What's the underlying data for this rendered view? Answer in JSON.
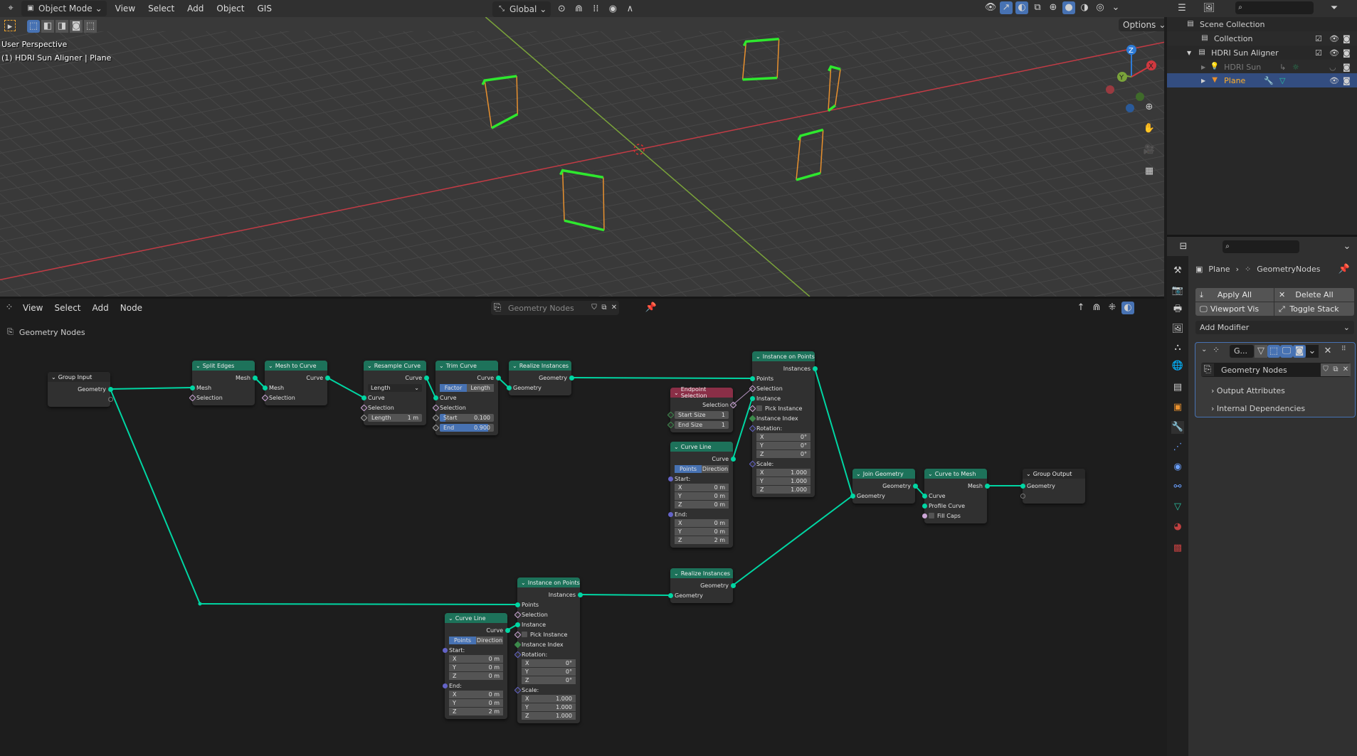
{
  "colors": {
    "accent": "#4772b3",
    "geometry_socket": "#00d6a3",
    "node_header_geometry": "#1d725a",
    "node_header_input": "#8a2f47",
    "node_header_group": "#282828",
    "active_object": "#ffaf29",
    "x_axis": "#c33b45",
    "y_axis": "#7aa33a",
    "selection_green": "#2ee82e",
    "selection_orange": "#e8902e"
  },
  "top_header": {
    "editor_icon": "axis-gizmo-icon",
    "mode": "Object Mode",
    "menus": [
      "View",
      "Select",
      "Add",
      "Object",
      "GIS"
    ],
    "transform_orientation": "Global",
    "options": "Options"
  },
  "viewport": {
    "view_name": "User Perspective",
    "object_info": "(1) HDRI Sun Aligner | Plane",
    "gizmo": {
      "x": "X",
      "y": "Y",
      "z": "Z"
    }
  },
  "outliner": {
    "rows": [
      {
        "label": "Scene Collection",
        "icon": "collection-icon"
      },
      {
        "label": "Collection",
        "icon": "collection-icon"
      },
      {
        "label": "HDRI Sun Aligner",
        "icon": "collection-icon"
      },
      {
        "label": "HDRI Sun",
        "icon": "light-icon"
      },
      {
        "label": "Plane",
        "icon": "mesh-icon",
        "selected": true
      }
    ]
  },
  "properties": {
    "breadcrumb": [
      "Plane",
      "GeometryNodes"
    ],
    "apply_all": "Apply All",
    "delete_all": "Delete All",
    "viewport_vis": "Viewport Vis",
    "toggle_stack": "Toggle Stack",
    "add_modifier": "Add Modifier",
    "modifier": {
      "name": "G...",
      "node_group": "Geometry Nodes",
      "sections": [
        "Output Attributes",
        "Internal Dependencies"
      ]
    }
  },
  "node_editor": {
    "menus": [
      "View",
      "Select",
      "Add",
      "Node"
    ],
    "node_group": "Geometry Nodes",
    "breadcrumb": "Geometry Nodes"
  },
  "nodes": {
    "group_input": {
      "title": "Group Input",
      "header": "group",
      "rows": [
        {
          "k": "out",
          "label": "Geometry",
          "s": "geo"
        },
        {
          "k": "out",
          "label": "",
          "s": "empty"
        }
      ]
    },
    "split_edges": {
      "title": "Split Edges",
      "header": "geo",
      "rows": [
        {
          "k": "out",
          "label": "Mesh",
          "s": "geo"
        },
        {
          "k": "in",
          "label": "Mesh",
          "s": "geo"
        },
        {
          "k": "in",
          "label": "Selection",
          "s": "field"
        }
      ]
    },
    "mesh_to_curve": {
      "title": "Mesh to Curve",
      "header": "geo",
      "rows": [
        {
          "k": "out",
          "label": "Curve",
          "s": "geo"
        },
        {
          "k": "in",
          "label": "Mesh",
          "s": "geo"
        },
        {
          "k": "in",
          "label": "Selection",
          "s": "field"
        }
      ]
    },
    "resample": {
      "title": "Resample Curve",
      "header": "geo",
      "rows": [
        {
          "k": "out",
          "label": "Curve",
          "s": "geo"
        },
        {
          "k": "select",
          "label": "Length"
        },
        {
          "k": "in",
          "label": "Curve",
          "s": "geo"
        },
        {
          "k": "in",
          "label": "Selection",
          "s": "field"
        },
        {
          "k": "field",
          "label": "Length",
          "value": "1 m",
          "s": "float"
        }
      ]
    },
    "trim": {
      "title": "Trim Curve",
      "header": "geo",
      "rows": [
        {
          "k": "out",
          "label": "Curve",
          "s": "geo"
        },
        {
          "k": "toggle",
          "options": [
            "Factor",
            "Length"
          ],
          "active": 0
        },
        {
          "k": "in",
          "label": "Curve",
          "s": "geo"
        },
        {
          "k": "in",
          "label": "Selection",
          "s": "field"
        },
        {
          "k": "field",
          "label": "Start",
          "value": "0.100",
          "fill": 0.1,
          "s": "float"
        },
        {
          "k": "field",
          "label": "End",
          "value": "0.900",
          "fill": 0.9,
          "s": "float"
        }
      ]
    },
    "realize1": {
      "title": "Realize Instances",
      "header": "geo",
      "rows": [
        {
          "k": "out",
          "label": "Geometry",
          "s": "geo"
        },
        {
          "k": "in",
          "label": "Geometry",
          "s": "geo"
        }
      ]
    },
    "endpoint": {
      "title": "Endpoint Selection",
      "header": "input",
      "rows": [
        {
          "k": "out",
          "label": "Selection",
          "s": "field"
        },
        {
          "k": "field",
          "label": "Start Size",
          "value": "1",
          "s": "intd"
        },
        {
          "k": "field",
          "label": "End Size",
          "value": "1",
          "s": "intd"
        }
      ]
    },
    "iop1": {
      "title": "Instance on Points",
      "header": "geo",
      "rows": [
        {
          "k": "out",
          "label": "Instances",
          "s": "geo"
        },
        {
          "k": "in",
          "label": "Points",
          "s": "geo"
        },
        {
          "k": "in",
          "label": "Selection",
          "s": "field"
        },
        {
          "k": "in",
          "label": "Instance",
          "s": "geo"
        },
        {
          "k": "check",
          "label": "Pick Instance",
          "s": "field"
        },
        {
          "k": "in",
          "label": "Instance Index",
          "s": "int"
        },
        {
          "k": "in",
          "label": "Rotation:",
          "s": "vec"
        },
        {
          "k": "xyz",
          "label": "X",
          "value": "0°"
        },
        {
          "k": "xyz",
          "label": "Y",
          "value": "0°"
        },
        {
          "k": "xyz",
          "label": "Z",
          "value": "0°"
        },
        {
          "k": "in",
          "label": "Scale:",
          "s": "vec"
        },
        {
          "k": "xyz",
          "label": "X",
          "value": "1.000"
        },
        {
          "k": "xyz",
          "label": "Y",
          "value": "1.000"
        },
        {
          "k": "xyz",
          "label": "Z",
          "value": "1.000"
        }
      ]
    },
    "curveline1": {
      "title": "Curve Line",
      "header": "geo",
      "rows": [
        {
          "k": "out",
          "label": "Curve",
          "s": "geo"
        },
        {
          "k": "toggle",
          "options": [
            "Points",
            "Direction"
          ],
          "active": 0
        },
        {
          "k": "in",
          "label": "Start:",
          "s": "vecc"
        },
        {
          "k": "xyz",
          "label": "X",
          "value": "0 m"
        },
        {
          "k": "xyz",
          "label": "Y",
          "value": "0 m"
        },
        {
          "k": "xyz",
          "label": "Z",
          "value": "0 m"
        },
        {
          "k": "in",
          "label": "End:",
          "s": "vecc"
        },
        {
          "k": "xyz",
          "label": "X",
          "value": "0 m"
        },
        {
          "k": "xyz",
          "label": "Y",
          "value": "0 m"
        },
        {
          "k": "xyz",
          "label": "Z",
          "value": "2 m"
        }
      ]
    },
    "join": {
      "title": "Join Geometry",
      "header": "geo",
      "rows": [
        {
          "k": "out",
          "label": "Geometry",
          "s": "geo"
        },
        {
          "k": "in",
          "label": "Geometry",
          "s": "geo"
        }
      ]
    },
    "c2m": {
      "title": "Curve to Mesh",
      "header": "geo",
      "rows": [
        {
          "k": "out",
          "label": "Mesh",
          "s": "geo"
        },
        {
          "k": "in",
          "label": "Curve",
          "s": "geo"
        },
        {
          "k": "in",
          "label": "Profile Curve",
          "s": "geo"
        },
        {
          "k": "check",
          "label": "Fill Caps",
          "s": "bool"
        }
      ]
    },
    "group_output": {
      "title": "Group Output",
      "header": "group",
      "rows": [
        {
          "k": "in",
          "label": "Geometry",
          "s": "geo"
        },
        {
          "k": "in",
          "label": "",
          "s": "empty"
        }
      ]
    },
    "iop2": {
      "title": "Instance on Points",
      "header": "geo",
      "rows": [
        {
          "k": "out",
          "label": "Instances",
          "s": "geo"
        },
        {
          "k": "in",
          "label": "Points",
          "s": "geo"
        },
        {
          "k": "in",
          "label": "Selection",
          "s": "field"
        },
        {
          "k": "in",
          "label": "Instance",
          "s": "geo"
        },
        {
          "k": "check",
          "label": "Pick Instance",
          "s": "field"
        },
        {
          "k": "in",
          "label": "Instance Index",
          "s": "int"
        },
        {
          "k": "in",
          "label": "Rotation:",
          "s": "vec"
        },
        {
          "k": "xyz",
          "label": "X",
          "value": "0°"
        },
        {
          "k": "xyz",
          "label": "Y",
          "value": "0°"
        },
        {
          "k": "xyz",
          "label": "Z",
          "value": "0°"
        },
        {
          "k": "in",
          "label": "Scale:",
          "s": "vec"
        },
        {
          "k": "xyz",
          "label": "X",
          "value": "1.000"
        },
        {
          "k": "xyz",
          "label": "Y",
          "value": "1.000"
        },
        {
          "k": "xyz",
          "label": "Z",
          "value": "1.000"
        }
      ]
    },
    "curveline2": {
      "title": "Curve Line",
      "header": "geo",
      "rows": [
        {
          "k": "out",
          "label": "Curve",
          "s": "geo"
        },
        {
          "k": "toggle",
          "options": [
            "Points",
            "Direction"
          ],
          "active": 0
        },
        {
          "k": "in",
          "label": "Start:",
          "s": "vecc"
        },
        {
          "k": "xyz",
          "label": "X",
          "value": "0 m"
        },
        {
          "k": "xyz",
          "label": "Y",
          "value": "0 m"
        },
        {
          "k": "xyz",
          "label": "Z",
          "value": "0 m"
        },
        {
          "k": "in",
          "label": "End:",
          "s": "vecc"
        },
        {
          "k": "xyz",
          "label": "X",
          "value": "0 m"
        },
        {
          "k": "xyz",
          "label": "Y",
          "value": "0 m"
        },
        {
          "k": "xyz",
          "label": "Z",
          "value": "2 m"
        }
      ]
    },
    "realize2": {
      "title": "Realize Instances",
      "header": "geo",
      "rows": [
        {
          "k": "out",
          "label": "Geometry",
          "s": "geo"
        },
        {
          "k": "in",
          "label": "Geometry",
          "s": "geo"
        }
      ]
    }
  }
}
